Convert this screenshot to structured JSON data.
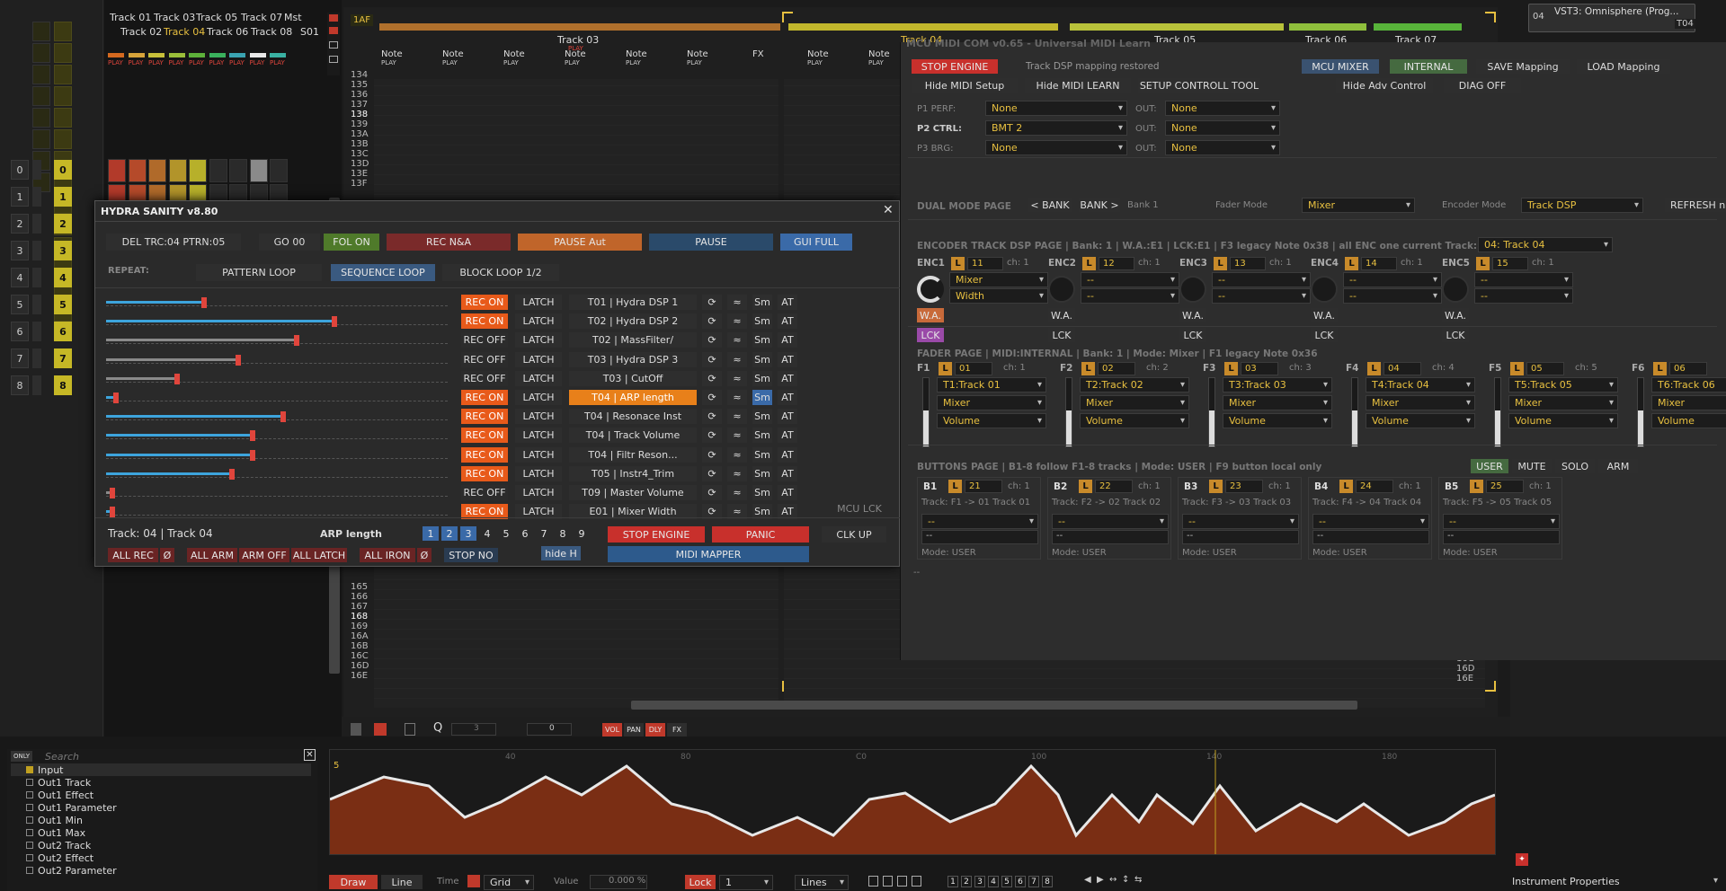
{
  "mixer": {
    "tracks_row1": [
      "Track 01",
      "Track 03",
      "Track 05",
      "Track 07",
      "Mst"
    ],
    "tracks_row2": [
      "Track 02",
      "Track 04",
      "Track 06",
      "Track 08",
      "S01"
    ],
    "play_label": "PLAY",
    "numbers": [
      "0",
      "1",
      "2",
      "3",
      "4",
      "5",
      "6",
      "7",
      "8"
    ]
  },
  "arranger": {
    "marker": "1AF",
    "tracks": [
      {
        "name": "Track 03",
        "color": "#b0702c"
      },
      {
        "name": "Track 04",
        "color": "#c2b72c"
      },
      {
        "name": "Track 05",
        "color": "#b8c23a"
      },
      {
        "name": "Track 06",
        "color": "#8fbf3c"
      },
      {
        "name": "Track 07",
        "color": "#58b43a"
      }
    ],
    "play_label": "PLAY",
    "column_label": "Note",
    "fx_label": "FX",
    "rows_top": [
      "134",
      "135",
      "136",
      "137",
      "138",
      "139",
      "13A",
      "13B",
      "13C",
      "13D",
      "13E",
      "13F"
    ],
    "rows_bottom": [
      "165",
      "166",
      "167",
      "168",
      "169",
      "16A",
      "16B",
      "16C",
      "16D",
      "16E"
    ],
    "right_rows": [
      "16C",
      "16D",
      "16E"
    ]
  },
  "hydra": {
    "title": "HYDRA SANITY v8.80",
    "top_buttons": [
      "DEL TRC:04 PTRN:05",
      "GO 00",
      "FOL ON",
      "REC N&A",
      "PAUSE Aut",
      "PAUSE",
      "GUI FULL"
    ],
    "repeat_label": "REPEAT:",
    "repeat_buttons": [
      "PATTERN LOOP",
      "SEQUENCE LOOP",
      "BLOCK LOOP 1/2"
    ],
    "latch": "LATCH",
    "sm": "Sm",
    "at": "AT",
    "wave": "≈",
    "loop_icon": "⟳",
    "rows": [
      {
        "rec": "REC ON",
        "name": "T01 | Hydra DSP 1",
        "fill": 0.28,
        "on": true
      },
      {
        "rec": "REC ON",
        "name": "T02 | Hydra  DSP 2",
        "fill": 0.66,
        "on": true
      },
      {
        "rec": "REC OFF",
        "name": "T02 | MassFilter/",
        "fill": 0.55,
        "on": false
      },
      {
        "rec": "REC OFF",
        "name": "T03 | Hydra DSP 3",
        "fill": 0.38,
        "on": false
      },
      {
        "rec": "REC OFF",
        "name": "T03 | CutOff",
        "fill": 0.2,
        "on": false
      },
      {
        "rec": "REC ON",
        "name": "T04 | ARP length",
        "fill": 0.02,
        "on": true
      },
      {
        "rec": "REC ON",
        "name": "T04 | Resonace Inst",
        "fill": 0.51,
        "on": true
      },
      {
        "rec": "REC ON",
        "name": "T04 | Track Volume",
        "fill": 0.42,
        "on": true
      },
      {
        "rec": "REC ON",
        "name": "T04 | Filtr Reson...",
        "fill": 0.42,
        "on": true
      },
      {
        "rec": "REC ON",
        "name": "T05 | Instr4_Trim",
        "fill": 0.36,
        "on": true
      },
      {
        "rec": "REC OFF",
        "name": "T09 | Master Volume",
        "fill": 0.01,
        "on": false
      },
      {
        "rec": "REC ON",
        "name": "E01 | Mixer Width",
        "fill": 0.01,
        "on": true
      }
    ],
    "mcu_lck": "MCU LCK",
    "track_info": "Track: 04 | Track 04",
    "arp_label": "ARP length",
    "arp_numbers": [
      "1",
      "2",
      "3",
      "4",
      "5",
      "6",
      "7",
      "8",
      "9"
    ],
    "stop_engine": "STOP ENGINE",
    "panic": "PANIC",
    "clk_up": "CLK UP",
    "midi_mapper": "MIDI MAPPER",
    "bottom_buttons": [
      "ALL REC",
      "Ø",
      "ALL ARM",
      "ARM OFF",
      "ALL LATCH",
      "ALL IRON",
      "Ø",
      "STOP NO",
      "hide H"
    ]
  },
  "mcu": {
    "title": "MCU MIDI COM v0.65 - Universal MIDI Learn",
    "stop_engine": "STOP ENGINE",
    "status": "Track DSP mapping restored",
    "mcu_mixer": "MCU MIXER",
    "internal": "INTERNAL",
    "save": "SAVE Mapping",
    "load": "LOAD Mapping",
    "row2": [
      "Hide MIDI Setup",
      "Hide MIDI LEARN",
      "SETUP CONTROLL TOOL",
      "Hide Adv Control",
      "DIAG OFF"
    ],
    "ports": [
      {
        "label": "P1 PERF:",
        "in": "None",
        "out": "None"
      },
      {
        "label": "P2 CTRL:",
        "in": "BMT 2",
        "out": "None"
      },
      {
        "label": "P3 BRG:",
        "in": "None",
        "out": "None"
      }
    ],
    "out_label": "OUT:",
    "dual_mode": "DUAL MODE PAGE",
    "bank_prev": "< BANK",
    "bank_next": "BANK >",
    "bank": "Bank 1",
    "fader_mode_label": "Fader Mode",
    "fader_mode": "Mixer",
    "encoder_mode_label": "Encoder Mode",
    "encoder_mode": "Track DSP",
    "refresh": "REFRESH na",
    "enc_header": "ENCODER TRACK DSP PAGE | Bank: 1 | W.A.:E1 | LCK:E1 | F3 legacy Note 0x38 | all ENC one current Track:",
    "enc_track": "04: Track 04",
    "encoders": [
      {
        "name": "ENC1",
        "val": "11",
        "ch": "ch: 1",
        "p1": "Mixer",
        "p2": "Width"
      },
      {
        "name": "ENC2",
        "val": "12",
        "ch": "ch: 1",
        "p1": "--",
        "p2": "--"
      },
      {
        "name": "ENC3",
        "val": "13",
        "ch": "ch: 1",
        "p1": "--",
        "p2": "--"
      },
      {
        "name": "ENC4",
        "val": "14",
        "ch": "ch: 1",
        "p1": "--",
        "p2": "--"
      },
      {
        "name": "ENC5",
        "val": "15",
        "ch": "ch: 1",
        "p1": "--",
        "p2": "--"
      }
    ],
    "wa": "W.A.",
    "lck": "LCK",
    "l": "L",
    "fader_header": "FADER PAGE | MIDI:INTERNAL | Bank: 1 | Mode: Mixer | F1 legacy Note 0x36",
    "faders": [
      {
        "name": "F1",
        "val": "01",
        "ch": "ch: 1",
        "t": "T1:Track 01"
      },
      {
        "name": "F2",
        "val": "02",
        "ch": "ch: 2",
        "t": "T2:Track 02"
      },
      {
        "name": "F3",
        "val": "03",
        "ch": "ch: 3",
        "t": "T3:Track 03"
      },
      {
        "name": "F4",
        "val": "04",
        "ch": "ch: 4",
        "t": "T4:Track 04"
      },
      {
        "name": "F5",
        "val": "05",
        "ch": "ch: 5",
        "t": "T5:Track 05"
      },
      {
        "name": "F6",
        "val": "06",
        "ch": "",
        "t": "T6:Track 06"
      }
    ],
    "mixer": "Mixer",
    "volume": "Volume",
    "buttons_header": "BUTTONS PAGE | B1-8 follow F1-8 tracks | Mode: USER | F9 button local only",
    "mode_buttons": [
      "USER",
      "MUTE",
      "SOLO",
      "ARM"
    ],
    "buttons": [
      {
        "name": "B1",
        "val": "21",
        "ch": "ch: 1",
        "t": "Track: F1 -> 01 Track 01"
      },
      {
        "name": "B2",
        "val": "22",
        "ch": "ch: 1",
        "t": "Track: F2 -> 02 Track 02"
      },
      {
        "name": "B3",
        "val": "23",
        "ch": "ch: 1",
        "t": "Track: F3 -> 03 Track 03"
      },
      {
        "name": "B4",
        "val": "24",
        "ch": "ch: 1",
        "t": "Track: F4 -> 04 Track 04"
      },
      {
        "name": "B5",
        "val": "25",
        "ch": "ch: 1",
        "t": "Track: F5 -> 05 Track 05"
      }
    ],
    "dashes": "--",
    "mode_user": "Mode: USER",
    "footer": "--"
  },
  "vst": {
    "label": "VST3: Omnisphere (Prog...",
    "num": "04",
    "tag": "T04"
  },
  "bottom": {
    "search_placeholder": "Search",
    "only": "ONLY",
    "outputs": [
      "Input",
      "Out1 Track",
      "Out1 Effect",
      "Out1 Parameter",
      "Out1 Min",
      "Out1 Max",
      "Out2 Track",
      "Out2 Effect",
      "Out2 Parameter"
    ],
    "toolbar_mid": [
      "VOL",
      "PAN",
      "DLY",
      "FX"
    ],
    "env_value": "5",
    "ruler": [
      "40",
      "80",
      "C0",
      "100",
      "140",
      "180"
    ],
    "draw": "Draw",
    "line": "Line",
    "time_label": "Time",
    "grid": "Grid",
    "value_label": "Value",
    "value": "0.000 %",
    "lock": "Lock",
    "lock_val": "1",
    "lines": "Lines",
    "pages": [
      "1",
      "2",
      "3",
      "4",
      "5",
      "6",
      "7",
      "8"
    ],
    "instrument_properties": "Instrument Properties",
    "q_value": "3",
    "off_value": "0"
  }
}
